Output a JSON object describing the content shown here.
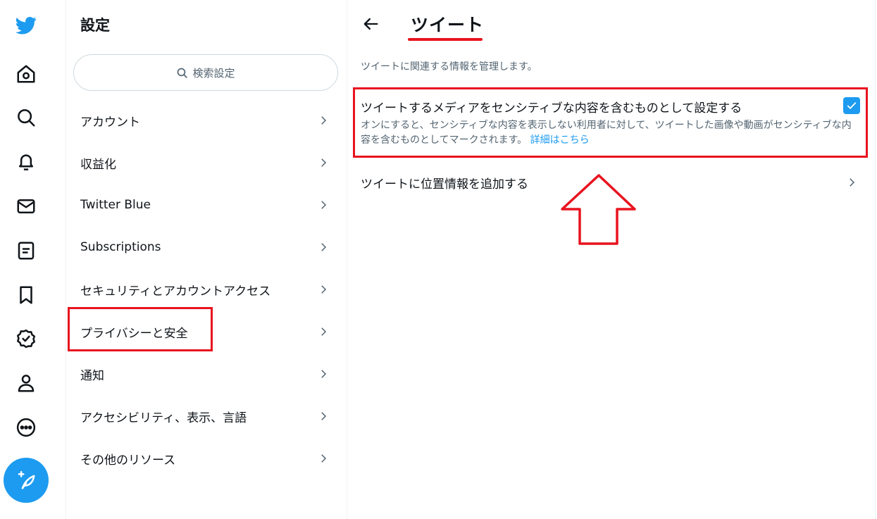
{
  "settings": {
    "title": "設定",
    "search_placeholder": "検索設定",
    "menu": [
      {
        "label": "アカウント"
      },
      {
        "label": "収益化"
      },
      {
        "label": "Twitter Blue"
      },
      {
        "label": "Subscriptions"
      },
      {
        "label": "セキュリティとアカウントアクセス"
      },
      {
        "label": "プライバシーと安全"
      },
      {
        "label": "通知"
      },
      {
        "label": "アクセシビリティ、表示、言語"
      },
      {
        "label": "その他のリソース"
      }
    ]
  },
  "detail": {
    "title": "ツイート",
    "description": "ツイートに関連する情報を管理します。",
    "sensitive_media": {
      "label": "ツイートするメディアをセンシティブな内容を含むものとして設定する",
      "help": "オンにすると、センシティブな内容を表示しない利用者に対して、ツイートした画像や動画がセンシティブな内容を含むものとしてマークされます。",
      "link": "詳細はこちら",
      "checked": true
    },
    "location": {
      "label": "ツイートに位置情報を追加する"
    }
  },
  "rail_icons": [
    "twitter-logo-icon",
    "home-icon",
    "search-icon",
    "bell-icon",
    "mail-icon",
    "lists-icon",
    "bookmark-icon",
    "verified-icon",
    "profile-icon",
    "more-icon",
    "compose-icon"
  ],
  "colors": {
    "accent": "#1d9bf0",
    "highlight": "#e8131f",
    "text": "#0f1419",
    "muted": "#536471"
  }
}
